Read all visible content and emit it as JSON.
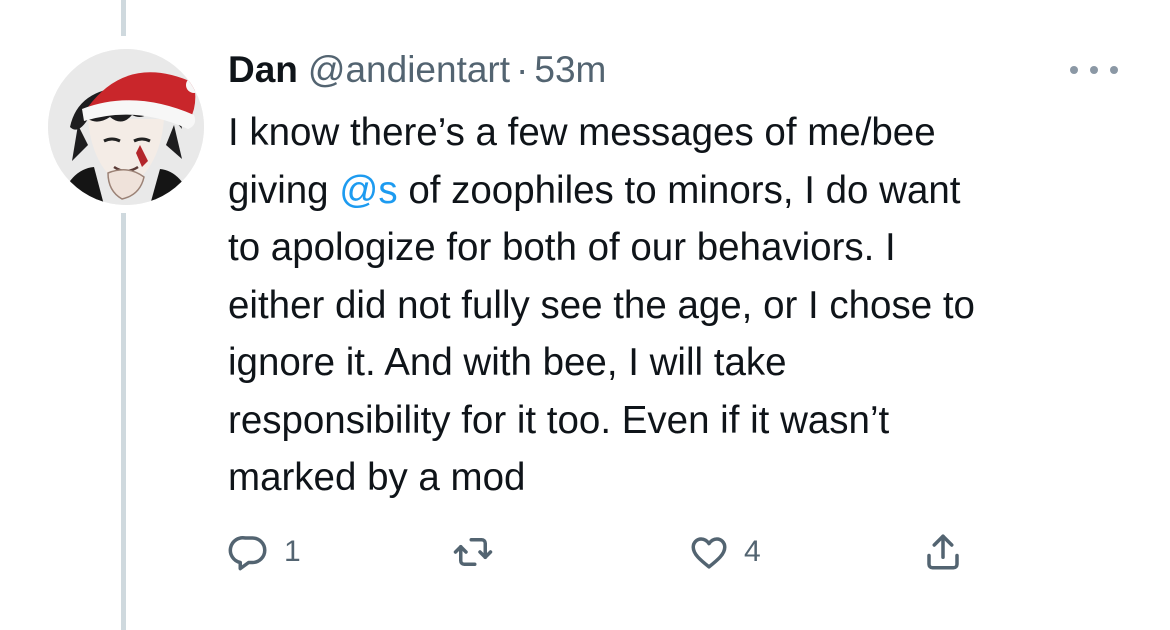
{
  "tweet": {
    "author_name": "Dan",
    "handle": "@andientart",
    "separator": "·",
    "time": "53m",
    "lines": [
      {
        "before": "I know there’s a few messages of me/bee",
        "mention": "",
        "after": ""
      },
      {
        "before": "giving ",
        "mention": "@s",
        "after": " of zoophiles to minors, I do want"
      },
      {
        "before": "to apologize for both of our behaviors. I",
        "mention": "",
        "after": ""
      },
      {
        "before": "either did not fully see the age, or I chose to",
        "mention": "",
        "after": ""
      },
      {
        "before": "ignore it. And with bee, I will take",
        "mention": "",
        "after": ""
      },
      {
        "before": "responsibility for it too. Even if it wasn’t",
        "mention": "",
        "after": ""
      },
      {
        "before": "marked by a mod",
        "mention": "",
        "after": ""
      }
    ],
    "actions": {
      "reply": {
        "icon": "reply-icon",
        "count": "1"
      },
      "retweet": {
        "icon": "retweet-icon",
        "count": ""
      },
      "like": {
        "icon": "heart-icon",
        "count": "4"
      },
      "share": {
        "icon": "share-icon",
        "count": ""
      }
    }
  },
  "colors": {
    "text": "#0f1419",
    "muted": "#536471",
    "mention": "#1d9bf0",
    "thread_line": "#cfd9de"
  }
}
